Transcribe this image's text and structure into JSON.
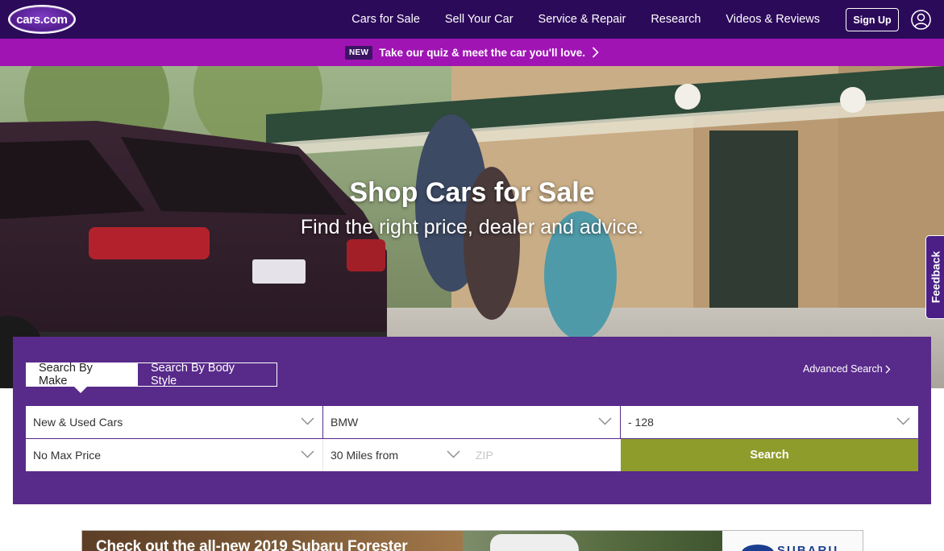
{
  "brand": {
    "logo_text": "cars.com"
  },
  "nav": {
    "links": [
      "Cars for Sale",
      "Sell Your Car",
      "Service & Repair",
      "Research",
      "Videos & Reviews"
    ],
    "signup_label": "Sign Up"
  },
  "promo": {
    "badge": "NEW",
    "text": "Take our quiz & meet the car you'll love."
  },
  "hero": {
    "title": "Shop Cars for Sale",
    "subtitle": "Find the right price, dealer and advice."
  },
  "feedback_label": "Feedback",
  "search": {
    "tabs": [
      "Search By Make",
      "Search By Body Style"
    ],
    "active_tab": "Search By Make",
    "advanced_label": "Advanced Search",
    "stock_type": "New & Used Cars",
    "make": "BMW",
    "model": "- 128",
    "max_price": "No Max Price",
    "distance": "30 Miles from",
    "zip_placeholder": "ZIP",
    "search_label": "Search"
  },
  "ad": {
    "headline": "Check out the all-new 2019 Subaru Forester",
    "sponsor": "SUBARU"
  },
  "colors": {
    "nav_bg": "#2c0a5a",
    "promo_bg": "#a014b4",
    "panel_bg": "#582a8a",
    "search_button": "#8e9c2c"
  }
}
